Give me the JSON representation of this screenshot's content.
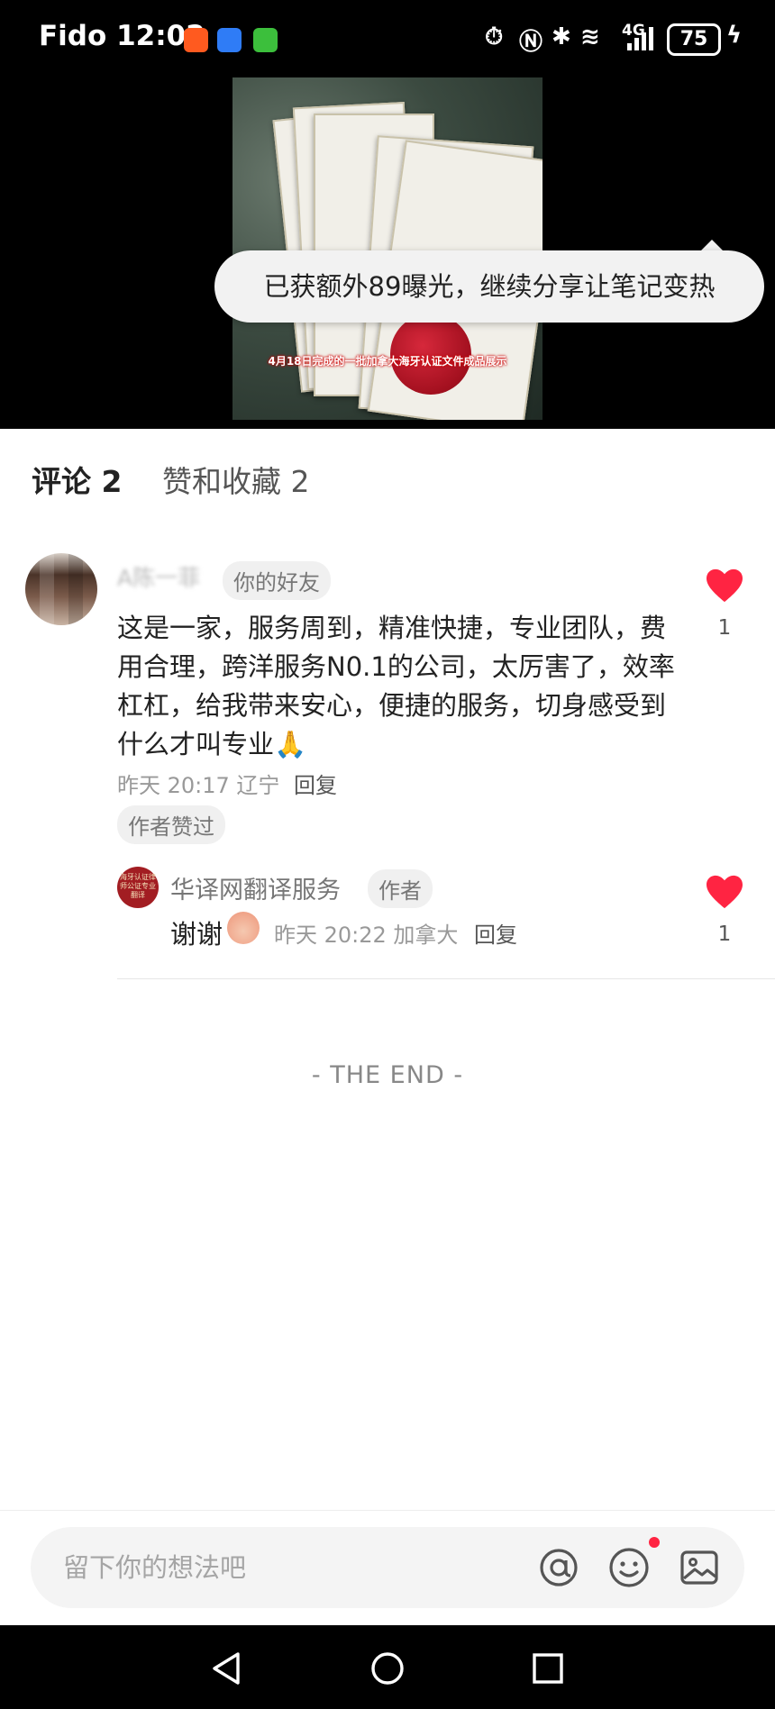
{
  "status_bar": {
    "carrier": "Fido",
    "time": "12:02",
    "network": "4G",
    "battery": "75"
  },
  "media": {
    "photo_caption": "4月18日完成的一批加拿大海牙认证文件成品展示",
    "toast": "已获额外89曝光，继续分享让笔记变热"
  },
  "tabs": {
    "comments": "评论 2",
    "likes": "赞和收藏 2"
  },
  "comments": [
    {
      "author": "A陈一菲",
      "friend_badge": "你的好友",
      "text": "这是一家，服务周到，精准快捷，专业团队，费用合理，跨洋服务N0.1的公司，太厉害了，效率杠杠，给我带来安心，便捷的服务，切身感受到什么才叫专业🙏",
      "meta": "昨天 20:17 辽宁",
      "reply_label": "回复",
      "author_liked_badge": "作者赞过",
      "like_count": "1"
    }
  ],
  "reply": {
    "avatar_text": "海牙认证律师公证专业翻译",
    "author": "华译网翻译服务",
    "author_badge": "作者",
    "text": "谢谢",
    "meta": "昨天 20:22 加拿大",
    "reply_label": "回复",
    "like_count": "1"
  },
  "end_marker": "- THE END -",
  "input_bar": {
    "placeholder": "留下你的想法吧",
    "icons": [
      "at-icon",
      "emoji-icon",
      "image-icon"
    ]
  },
  "colors": {
    "accent_red": "#ff2442",
    "background": "#ffffff",
    "media_background": "#000000"
  }
}
